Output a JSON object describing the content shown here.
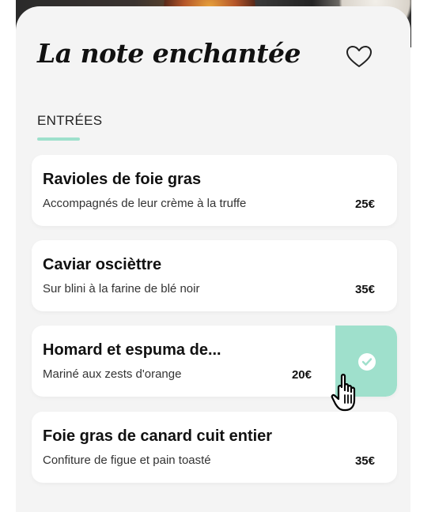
{
  "restaurant": {
    "title": "La note enchantée"
  },
  "section": {
    "label": "ENTRÉES"
  },
  "menu_items": [
    {
      "name": "Ravioles de foie gras",
      "description": "Accompagnés de leur crème à la truffe",
      "price": "25€"
    },
    {
      "name": "Caviar oscièttre",
      "description": "Sur blini à la farine de blé noir",
      "price": "35€"
    },
    {
      "name": "Homard et espuma de...",
      "description": "Mariné aux zests d'orange",
      "price": "20€"
    },
    {
      "name": "Foie gras de canard cuit entier",
      "description": "Confiture de figue et pain toasté",
      "price": "35€"
    }
  ],
  "icons": {
    "favorite": "heart-icon",
    "confirm": "check-circle-icon",
    "pointer": "hand-pointer-icon"
  },
  "colors": {
    "accent": "#9fe0cc",
    "card_background": "#f4f4f4"
  }
}
